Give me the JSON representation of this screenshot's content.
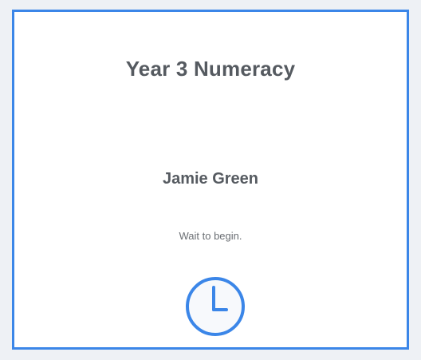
{
  "assessment": {
    "title": "Year 3 Numeracy"
  },
  "student": {
    "name": "Jamie Green"
  },
  "status": {
    "message": "Wait to begin.",
    "icon": "clock-icon"
  },
  "colors": {
    "accent": "#3b86e8",
    "text": "#555a60",
    "background": "#eef1f5"
  }
}
